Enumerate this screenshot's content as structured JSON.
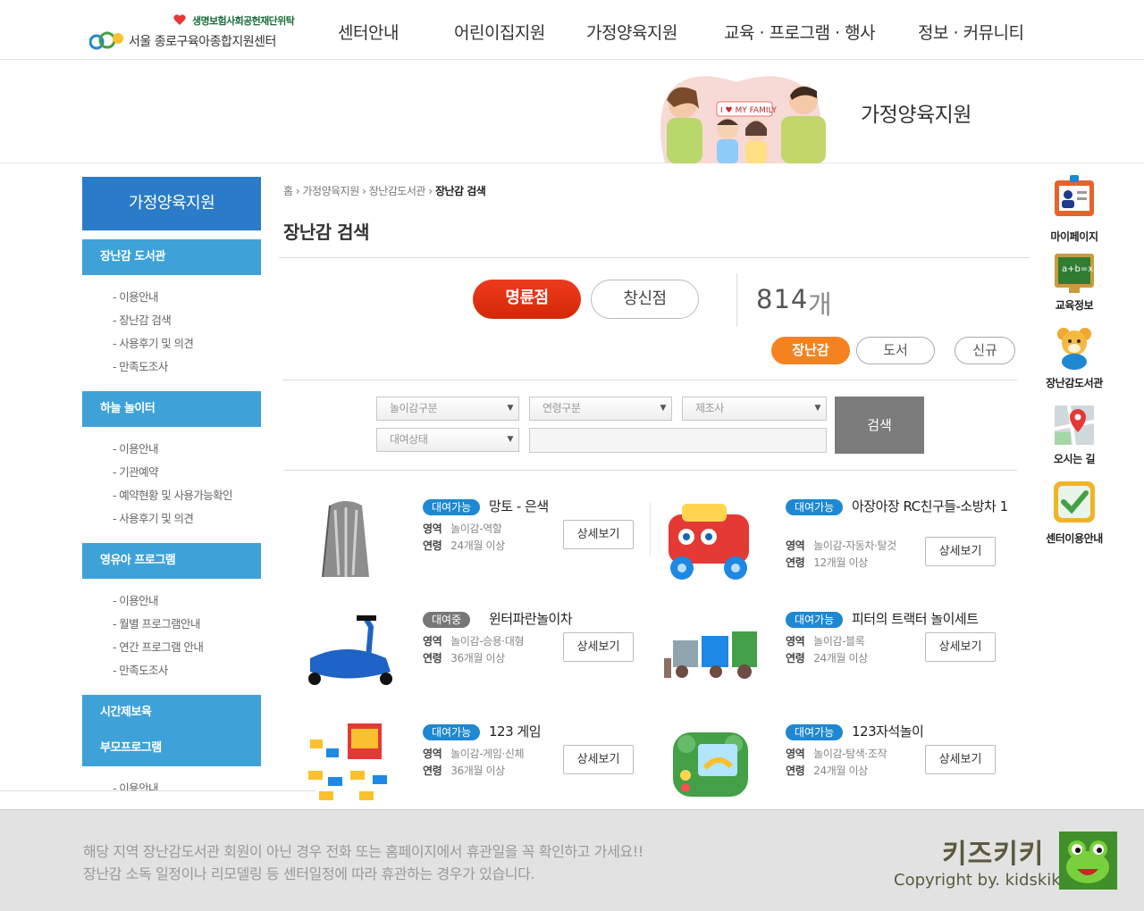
{
  "header": {
    "badge": "생명보험사회공헌재단위탁",
    "org_name": "서울 종로구육아종합지원센터",
    "nav": [
      "센터안내",
      "어린이집지원",
      "가정양육지원",
      "교육 · 프로그램 · 행사",
      "정보 · 커뮤니티"
    ]
  },
  "visual": {
    "title": "가정양육지원",
    "banner_text": "I ♥ MY FAMILY"
  },
  "sidebar": {
    "title": "가정양육지원",
    "groups": [
      {
        "label": "장난감 도서관",
        "items": [
          "- 이용안내",
          "- 장난감 검색",
          "- 사용후기 및 의견",
          "- 만족도조사"
        ]
      },
      {
        "label": "하늘 놀이터",
        "items": [
          "- 이용안내",
          "- 기관예약",
          "- 예약현황 및 사용가능확인",
          "- 사용후기 및 의견"
        ]
      },
      {
        "label": "영유아 프로그램",
        "items": [
          "- 이용안내",
          "- 월별 프로그램안내",
          "- 연간 프로그램 안내",
          "- 만족도조사"
        ]
      },
      {
        "label": "시간제보육",
        "items": []
      },
      {
        "label": "부모프로그램",
        "items": [
          "- 이용안내"
        ]
      }
    ]
  },
  "breadcrumb": {
    "home": "홈",
    "level1": "가정양육지원",
    "level2": "장난감도서관",
    "current": "장난감 검색"
  },
  "page_title": "장난감 검색",
  "stores": {
    "active": "명륜점",
    "other": "창신점"
  },
  "result_count": {
    "number": "814",
    "unit": "개"
  },
  "types": {
    "toy": "장난감",
    "book": "도서",
    "new": "신규"
  },
  "filters": {
    "play_type": "놀이감구분",
    "age": "연령구분",
    "maker": "제조사",
    "status": "대여상태",
    "keyword": "",
    "search_label": "검색"
  },
  "items": [
    {
      "status": "대여가능",
      "name": "망토 - 은색",
      "area": "놀이감-역할",
      "age": "24개월 이상",
      "available": true
    },
    {
      "status": "대여가능",
      "name": "아장아장 RC친구들-소방차 1",
      "area": "놀이감-자동차·탈것",
      "age": "12개월 이상",
      "available": true
    },
    {
      "status": "대여중",
      "name": "윈터파란놀이차",
      "area": "놀이감-승용·대형",
      "age": "36개월 이상",
      "available": false
    },
    {
      "status": "대여가능",
      "name": "피터의 트랙터 놀이세트",
      "area": "놀이감-블록",
      "age": "24개월 이상",
      "available": true
    },
    {
      "status": "대여가능",
      "name": "123 게임",
      "area": "놀이감-게임·신체",
      "age": "36개월 이상",
      "available": true
    },
    {
      "status": "대여가능",
      "name": "123자석놀이",
      "area": "놀이감-탐색·조작",
      "age": "24개월 이상",
      "available": true
    }
  ],
  "labels": {
    "area": "영역",
    "age": "연령",
    "detail": "상세보기"
  },
  "quick_menu": [
    "마이페이지",
    "교육정보",
    "장난감도서관",
    "오시는 길",
    "센터이용안내"
  ],
  "footer": {
    "line1": "해당 지역 장난감도서관 회원이 아닌 경우  전화 또는 홈페이지에서 휴관일을 꼭 확인하고 가세요!!",
    "line2": "장난감 소독 일정이나 리모델링 등 센터일정에 따라 휴관하는 경우가 있습니다.",
    "brand": "키즈키키",
    "copyright": "Copyright by. kidskiki"
  },
  "colors": {
    "primary_blue": "#2a7bc8",
    "sidebar_cat": "#3ea2d8",
    "store_active": "#e0300f",
    "type_active": "#f58220",
    "badge_available": "#1e88d2",
    "badge_rented": "#777777"
  }
}
